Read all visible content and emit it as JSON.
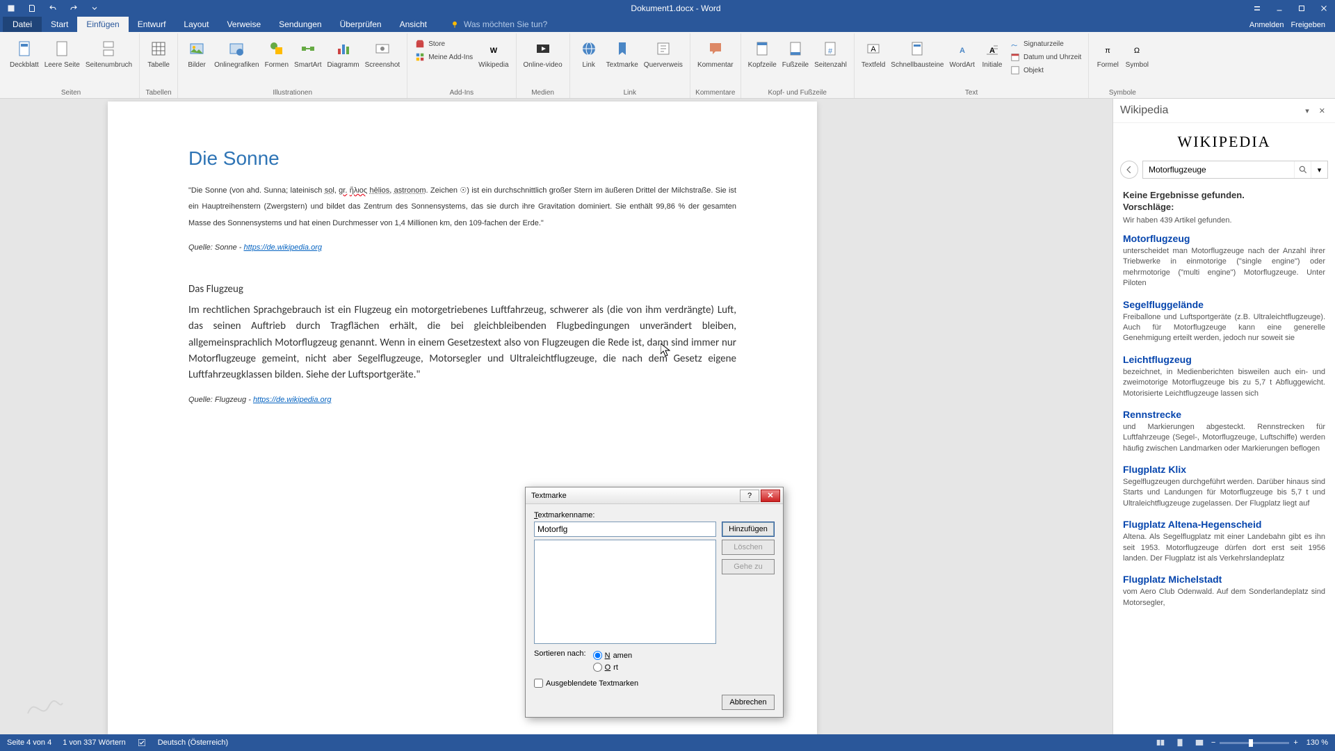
{
  "titlebar": {
    "title": "Dokument1.docx - Word"
  },
  "menutabs": {
    "file": "Datei",
    "items": [
      "Start",
      "Einfügen",
      "Entwurf",
      "Layout",
      "Verweise",
      "Sendungen",
      "Überprüfen",
      "Ansicht"
    ],
    "active": 1,
    "tellme": "Was möchten Sie tun?",
    "signin": "Anmelden",
    "share": "Freigeben"
  },
  "ribbon": {
    "groups": [
      {
        "label": "Seiten",
        "items": [
          {
            "label": "Deckblatt"
          },
          {
            "label": "Leere Seite"
          },
          {
            "label": "Seitenumbruch"
          }
        ]
      },
      {
        "label": "Tabellen",
        "items": [
          {
            "label": "Tabelle"
          }
        ]
      },
      {
        "label": "Illustrationen",
        "items": [
          {
            "label": "Bilder"
          },
          {
            "label": "Onlinegrafiken"
          },
          {
            "label": "Formen"
          },
          {
            "label": "SmartArt"
          },
          {
            "label": "Diagramm"
          },
          {
            "label": "Screenshot"
          }
        ]
      },
      {
        "label": "Add-Ins",
        "items": [
          {
            "label": "Store"
          },
          {
            "label": "Meine Add-Ins "
          },
          {
            "label": "Wikipedia"
          }
        ]
      },
      {
        "label": "Medien",
        "items": [
          {
            "label": "Online-video"
          }
        ]
      },
      {
        "label": "Link",
        "items": [
          {
            "label": "Link"
          },
          {
            "label": "Textmarke"
          },
          {
            "label": "Querverweis"
          }
        ]
      },
      {
        "label": "Kommentare",
        "items": [
          {
            "label": "Kommentar"
          }
        ]
      },
      {
        "label": "Kopf- und Fußzeile",
        "items": [
          {
            "label": "Kopfzeile"
          },
          {
            "label": "Fußzeile"
          },
          {
            "label": "Seitenzahl"
          }
        ]
      },
      {
        "label": "Text",
        "items": [
          {
            "label": "Textfeld"
          },
          {
            "label": "Schnellbausteine"
          },
          {
            "label": "WordArt"
          },
          {
            "label": "Initiale"
          },
          {
            "label": "Signaturzeile "
          },
          {
            "label": "Datum und Uhrzeit"
          },
          {
            "label": "Objekt "
          }
        ]
      },
      {
        "label": "Symbole",
        "items": [
          {
            "label": "Formel"
          },
          {
            "label": "Symbol"
          }
        ]
      }
    ]
  },
  "doc": {
    "h1": "Die Sonne",
    "p1a": "\"Die Sonne (von ahd. Sunna; lateinisch ",
    "sol": "sol",
    "p1b": ", ",
    "gr": "gr.",
    "p1c": " ",
    "helios1": "ἥλιος",
    "p1d": " ",
    "helios2": "hēlios",
    "p1e": ", ",
    "astronom": "astronom",
    "p1f": ". Zeichen ☉) ist ein durchschnittlich großer Stern im äußeren Drittel der Milchstraße. Sie ist ein Hauptreihenstern (Zwergstern) und bildet das Zentrum des Sonnensystems, das sie durch ihre Gravitation dominiert. Sie enthält 99,86 % der gesamten Masse des Sonnensystems und hat einen Durchmesser von 1,4 Millionen km, den 109-fachen der Erde.\"",
    "src1_pre": "Quelle: Sonne - ",
    "src1_url": "https://de.wikipedia.org",
    "h2": "Das Flugzeug",
    "p2": "Im rechtlichen Sprachgebrauch ist ein Flugzeug ein motorgetriebenes Luftfahrzeug, schwerer als (die von ihm verdrängte) Luft, das seinen Auftrieb durch Tragflächen erhält, die bei gleichbleibenden Flugbedingungen unverändert bleiben, allgemeinsprachlich Motorflugzeug genannt. Wenn in einem Gesetzestext also von Flugzeugen die Rede ist, dann sind immer nur Motorflugzeuge gemeint, nicht aber Segelflugzeuge, Motorsegler und Ultraleichtflugzeuge, die nach dem Gesetz eigene Luftfahrzeugklassen bilden. Siehe der Luftsportgeräte.\"",
    "src2_pre": "Quelle: Flugzeug - ",
    "src2_url": "https://de.wikipedia.org"
  },
  "dialog": {
    "title": "Textmarke",
    "name_label": "Textmarkenname:",
    "name_value": "Motorflg",
    "add": "Hinzufügen",
    "del": "Löschen",
    "goto": "Gehe zu",
    "sort_label": "Sortieren nach:",
    "sort_name": "Namen",
    "sort_loc": "Ort",
    "hidden": "Ausgeblendete Textmarken",
    "cancel": "Abbrechen"
  },
  "wiki": {
    "title": "Wikipedia",
    "logo": "WIKIPEDIA",
    "search": "Motorflugzeuge",
    "nores": "Keine Ergebnisse gefunden.",
    "sugg": "Vorschläge:",
    "found": "Wir haben 439 Artikel gefunden.",
    "items": [
      {
        "t": "Motorflugzeug",
        "s": "unterscheidet man Motorflugzeuge nach der Anzahl ihrer Triebwerke in einmotorige (\"single engine\") oder mehrmotorige (\"multi engine\") Motorflugzeuge. Unter Piloten"
      },
      {
        "t": "Segelfluggelände",
        "s": "Freiballone und Luftsportgeräte (z.B. Ultraleichtflugzeuge). Auch für Motorflugzeuge kann eine generelle Genehmigung erteilt werden, jedoch nur soweit sie"
      },
      {
        "t": "Leichtflugzeug",
        "s": "bezeichnet, in Medienberichten bisweilen auch ein- und zweimotorige Motorflugzeuge bis zu 5,7 t Abfluggewicht. Motorisierte Leichtflugzeuge lassen sich"
      },
      {
        "t": "Rennstrecke",
        "s": "und Markierungen abgesteckt. Rennstrecken für Luftfahrzeuge (Segel-, Motorflugzeuge, Luftschiffe) werden häufig zwischen Landmarken oder Markierungen beflogen"
      },
      {
        "t": "Flugplatz Klix",
        "s": "Segelflugzeugen durchgeführt werden. Darüber hinaus sind Starts und Landungen für Motorflugzeuge bis 5,7 t und Ultraleichtflugzeuge zugelassen. Der Flugplatz liegt auf"
      },
      {
        "t": "Flugplatz Altena-Hegenscheid",
        "s": "Altena. Als Segelflugplatz mit einer Landebahn gibt es ihn seit 1953. Motorflugzeuge dürfen dort erst seit 1956 landen. Der Flugplatz ist als Verkehrslandeplatz"
      },
      {
        "t": "Flugplatz Michelstadt",
        "s": "vom Aero Club Odenwald. Auf dem Sonderlandeplatz sind Motorsegler,"
      }
    ]
  },
  "status": {
    "page": "Seite 4 von 4",
    "words": "1 von 337 Wörtern",
    "lang": "Deutsch (Österreich)",
    "zoom": "130 %"
  }
}
